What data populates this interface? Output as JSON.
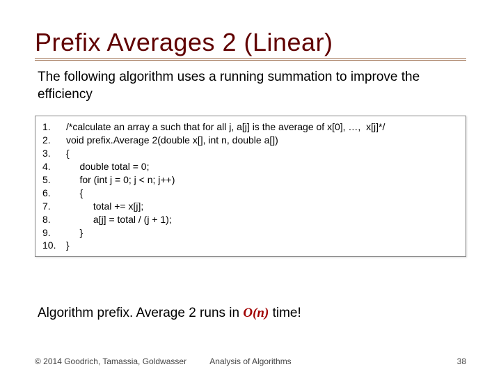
{
  "title": "Prefix Averages 2 (Linear)",
  "intro": "The following algorithm uses a running summation to improve the efficiency",
  "code": {
    "lines": [
      {
        "n": "1.",
        "t": "/*calculate an array a such that for all j, a[j] is the average of x[0], …,  x[j]*/"
      },
      {
        "n": "2.",
        "t": "void prefix.Average 2(double x[], int n, double a[])"
      },
      {
        "n": "3.",
        "t": "{"
      },
      {
        "n": "4.",
        "t": "     double total = 0;"
      },
      {
        "n": "5.",
        "t": "     for (int j = 0; j < n; j++)"
      },
      {
        "n": "6.",
        "t": "     {"
      },
      {
        "n": "7.",
        "t": "          total += x[j];"
      },
      {
        "n": "8.",
        "t": "          a[j] = total / (j + 1);"
      },
      {
        "n": "9.",
        "t": "     }"
      },
      {
        "n": "10.",
        "t": "}"
      }
    ]
  },
  "conclusion": {
    "prefix": "Algorithm ",
    "fn": "prefix. Average 2",
    "mid": " runs in ",
    "bigO": "O(n)",
    "suffix": " time!"
  },
  "footer": {
    "copyright": "© 2014 Goodrich, Tamassia, Goldwasser",
    "center": "Analysis of Algorithms",
    "page": "38"
  }
}
